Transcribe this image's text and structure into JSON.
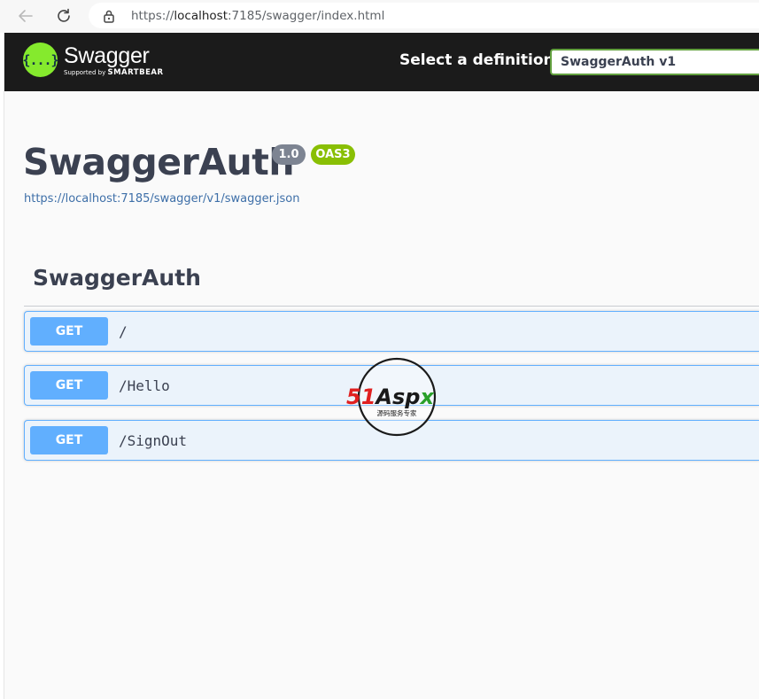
{
  "browser": {
    "url_prefix": "https://",
    "url_host": "localhost",
    "url_rest": ":7185/swagger/index.html"
  },
  "topbar": {
    "logo_glyph": "{...}",
    "logo_title": "Swagger",
    "logo_sub_prefix": "Supported by",
    "logo_sub_brand": "SMARTBEAR",
    "definition_label": "Select a definition",
    "definition_selected": "SwaggerAuth v1"
  },
  "info": {
    "title": "SwaggerAuth",
    "version": "1.0",
    "oas": "OAS3",
    "spec_url": "https://localhost:7185/swagger/v1/swagger.json"
  },
  "tag": {
    "name": "SwaggerAuth",
    "operations": [
      {
        "method": "GET",
        "path": "/"
      },
      {
        "method": "GET",
        "path": "/Hello"
      },
      {
        "method": "GET",
        "path": "/SignOut"
      }
    ]
  },
  "watermark": {
    "brand_red": "51",
    "brand_dark": "Asp",
    "brand_green": "x",
    "tagline": "源码服务专家"
  },
  "colors": {
    "get": "#61affe",
    "get_bg": "#ebf3fb",
    "topbar": "#1b1b1b",
    "logo_green": "#85ea2d",
    "oas_badge": "#89bf04",
    "version_badge": "#7d8492"
  },
  "icons": [
    "back-arrow-icon",
    "refresh-icon",
    "lock-icon",
    "swagger-logo-icon"
  ]
}
